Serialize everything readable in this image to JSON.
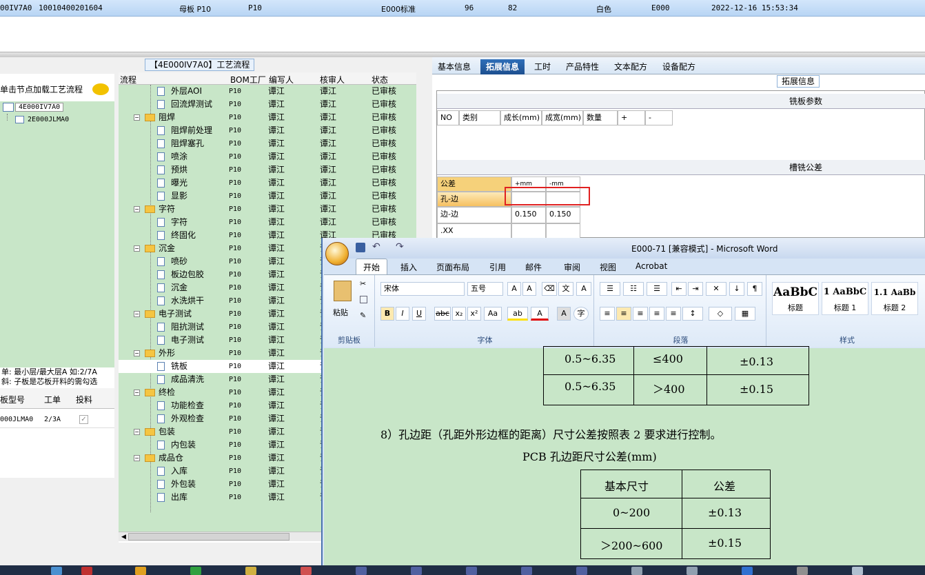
{
  "top_row": {
    "code": "00IV7A0",
    "part_no": "10010400201604",
    "board_type": "母板 P10",
    "factory": "P10",
    "standard": "E000标准",
    "n1": "96",
    "n2": "82",
    "color": "白色",
    "customer": "E000",
    "datetime": "2022-12-16 15:53:34"
  },
  "left_panel": {
    "header": "单击节点加载工艺流程",
    "tree": [
      "4E000IV7A0",
      "2E000JLMA0"
    ],
    "note_line1": "单: 最小层/最大层A 如:2/7A",
    "note_line2": "斜: 子板是芯板开料的需勾选",
    "grid_headers": [
      "板型号",
      "工单",
      "投料"
    ],
    "grid_row": {
      "model": "000JLMA0",
      "order": "2/3A",
      "feed": "✓"
    }
  },
  "tree_panel": {
    "title": "【4E000IV7A0】工艺流程",
    "columns": {
      "flow": "流程",
      "bom": "BOM工厂",
      "editor": "编写人",
      "reviewer": "核审人",
      "status": "状态"
    },
    "rows": [
      {
        "name": "外层AOI",
        "level": 2,
        "fac": "P10",
        "ed": "谭江",
        "rv": "谭江",
        "st": "已审核"
      },
      {
        "name": "回流焊测试",
        "level": 2,
        "fac": "P10",
        "ed": "谭江",
        "rv": "谭江",
        "st": "已审核"
      },
      {
        "name": "阻焊",
        "level": 1,
        "fac": "P10",
        "ed": "谭江",
        "rv": "谭江",
        "st": "已审核"
      },
      {
        "name": "阻焊前处理",
        "level": 2,
        "fac": "P10",
        "ed": "谭江",
        "rv": "谭江",
        "st": "已审核"
      },
      {
        "name": "阻焊塞孔",
        "level": 2,
        "fac": "P10",
        "ed": "谭江",
        "rv": "谭江",
        "st": "已审核"
      },
      {
        "name": "喷涂",
        "level": 2,
        "fac": "P10",
        "ed": "谭江",
        "rv": "谭江",
        "st": "已审核"
      },
      {
        "name": "预烘",
        "level": 2,
        "fac": "P10",
        "ed": "谭江",
        "rv": "谭江",
        "st": "已审核"
      },
      {
        "name": "曝光",
        "level": 2,
        "fac": "P10",
        "ed": "谭江",
        "rv": "谭江",
        "st": "已审核"
      },
      {
        "name": "显影",
        "level": 2,
        "fac": "P10",
        "ed": "谭江",
        "rv": "谭江",
        "st": "已审核"
      },
      {
        "name": "字符",
        "level": 1,
        "fac": "P10",
        "ed": "谭江",
        "rv": "谭江",
        "st": "已审核"
      },
      {
        "name": "字符",
        "level": 2,
        "fac": "P10",
        "ed": "谭江",
        "rv": "谭江",
        "st": "已审核"
      },
      {
        "name": "终固化",
        "level": 2,
        "fac": "P10",
        "ed": "谭江",
        "rv": "谭江",
        "st": "已审核"
      },
      {
        "name": "沉金",
        "level": 1,
        "fac": "P10",
        "ed": "谭江",
        "rv": "谭江",
        "st": ""
      },
      {
        "name": "喷砂",
        "level": 2,
        "fac": "P10",
        "ed": "谭江",
        "rv": "谭江",
        "st": ""
      },
      {
        "name": "板边包胶",
        "level": 2,
        "fac": "P10",
        "ed": "谭江",
        "rv": "谭江",
        "st": ""
      },
      {
        "name": "沉金",
        "level": 2,
        "fac": "P10",
        "ed": "谭江",
        "rv": "谭江",
        "st": ""
      },
      {
        "name": "水洗烘干",
        "level": 2,
        "fac": "P10",
        "ed": "谭江",
        "rv": "谭江",
        "st": ""
      },
      {
        "name": "电子测试",
        "level": 1,
        "fac": "P10",
        "ed": "谭江",
        "rv": "谭江",
        "st": ""
      },
      {
        "name": "阻抗测试",
        "level": 2,
        "fac": "P10",
        "ed": "谭江",
        "rv": "谭江",
        "st": ""
      },
      {
        "name": "电子测试",
        "level": 2,
        "fac": "P10",
        "ed": "谭江",
        "rv": "谭江",
        "st": ""
      },
      {
        "name": "外形",
        "level": 1,
        "fac": "P10",
        "ed": "谭江",
        "rv": "谭江",
        "st": ""
      },
      {
        "name": "铣板",
        "level": 2,
        "fac": "P10",
        "ed": "谭江",
        "rv": "谭江",
        "st": ""
      },
      {
        "name": "成品清洗",
        "level": 2,
        "fac": "P10",
        "ed": "谭江",
        "rv": "谭江",
        "st": ""
      },
      {
        "name": "终检",
        "level": 1,
        "fac": "P10",
        "ed": "谭江",
        "rv": "谭江",
        "st": ""
      },
      {
        "name": "功能检查",
        "level": 2,
        "fac": "P10",
        "ed": "谭江",
        "rv": "谭江",
        "st": ""
      },
      {
        "name": "外观检查",
        "level": 2,
        "fac": "P10",
        "ed": "谭江",
        "rv": "谭江",
        "st": ""
      },
      {
        "name": "包装",
        "level": 1,
        "fac": "P10",
        "ed": "谭江",
        "rv": "谭江",
        "st": ""
      },
      {
        "name": "内包装",
        "level": 2,
        "fac": "P10",
        "ed": "谭江",
        "rv": "谭江",
        "st": ""
      },
      {
        "name": "成品仓",
        "level": 1,
        "fac": "P10",
        "ed": "谭江",
        "rv": "谭江",
        "st": ""
      },
      {
        "name": "入库",
        "level": 2,
        "fac": "P10",
        "ed": "谭江",
        "rv": "谭江",
        "st": ""
      },
      {
        "name": "外包装",
        "level": 2,
        "fac": "P10",
        "ed": "谭江",
        "rv": "谭江",
        "st": ""
      },
      {
        "name": "出库",
        "level": 2,
        "fac": "P10",
        "ed": "谭江",
        "rv": "谭江",
        "st": ""
      }
    ]
  },
  "right_panel": {
    "tabs": [
      "基本信息",
      "拓展信息",
      "工时",
      "产品特性",
      "文本配方",
      "设备配方"
    ],
    "active_tab": "拓展信息",
    "caption": "拓展信息",
    "section1": "铣板参数",
    "s1_cols": [
      "NO",
      "类别",
      "成长(mm)",
      "成宽(mm)",
      "数量",
      "+",
      "-"
    ],
    "section2": "槽铣公差",
    "s2_header": {
      "label": "公差",
      "plus": "+mm",
      "minus": "-mm"
    },
    "s2_rows": [
      {
        "label": "孔-边",
        "plus": "",
        "minus": ""
      },
      {
        "label": "边-边",
        "plus": "0.150",
        "minus": "0.150"
      },
      {
        "label": ".XX",
        "plus": "",
        "minus": ""
      }
    ]
  },
  "word": {
    "title": "E000-71 [兼容模式] - Microsoft Word",
    "tabs": [
      "开始",
      "插入",
      "页面布局",
      "引用",
      "邮件",
      "审阅",
      "视图",
      "Acrobat"
    ],
    "active_tab": "开始",
    "ribbon": {
      "clipboard": "剪贴板",
      "paste": "粘贴",
      "font_group": "字体",
      "font_name": "宋体",
      "font_size": "五号",
      "paragraph": "段落",
      "styles": "样式",
      "style_items": [
        {
          "sample": "AaBbC",
          "label": "标题"
        },
        {
          "sample": "1 AaBbC",
          "label": "标题 1"
        },
        {
          "sample": "1.1 AaBb",
          "label": "标题 2"
        }
      ]
    },
    "doc": {
      "table1": [
        [
          "0.5~6.35",
          "≤400",
          "±0.13"
        ],
        [
          "0.5~6.35",
          "＞400",
          "±0.15"
        ]
      ],
      "para": "8）孔边距（孔距外形边框的距离）尺寸公差按照表 2 要求进行控制。",
      "table2_title": "PCB 孔边距尺寸公差(mm)",
      "table2_header": [
        "基本尺寸",
        "公差"
      ],
      "table2_rows": [
        [
          "0~200",
          "±0.13"
        ],
        [
          "＞200~600",
          "±0.15"
        ]
      ]
    }
  },
  "colors": {
    "green_bg": "#c8e6c8",
    "tab_active": "#2f6fb8",
    "highlight_red": "#e02020"
  }
}
